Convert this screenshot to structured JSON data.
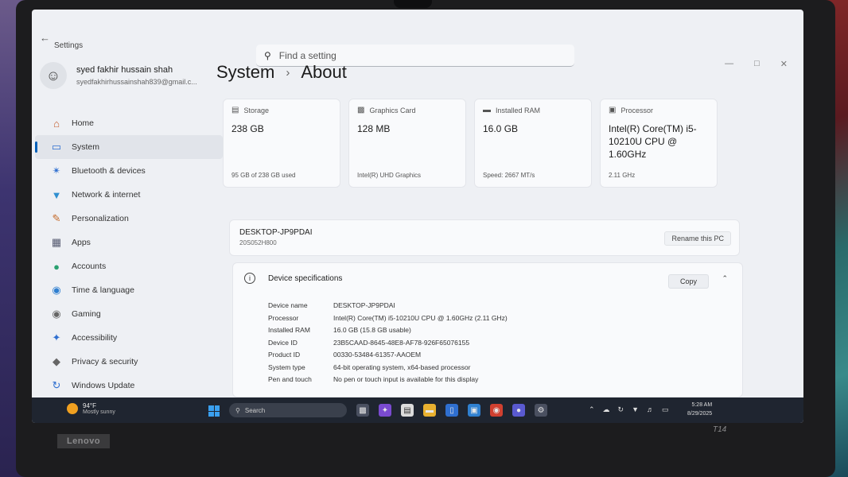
{
  "window": {
    "app_title": "Settings"
  },
  "search": {
    "placeholder": "Find a setting"
  },
  "user": {
    "name": "syed fakhir hussain shah",
    "email": "syedfakhirhussainshah839@gmail.c..."
  },
  "sidebar": {
    "items": [
      {
        "label": "Home",
        "icon": "home-icon"
      },
      {
        "label": "System",
        "icon": "system-icon",
        "active": true
      },
      {
        "label": "Bluetooth & devices",
        "icon": "bluetooth-icon"
      },
      {
        "label": "Network & internet",
        "icon": "network-icon"
      },
      {
        "label": "Personalization",
        "icon": "brush-icon"
      },
      {
        "label": "Apps",
        "icon": "apps-icon"
      },
      {
        "label": "Accounts",
        "icon": "accounts-icon"
      },
      {
        "label": "Time & language",
        "icon": "globe-icon"
      },
      {
        "label": "Gaming",
        "icon": "gamepad-icon"
      },
      {
        "label": "Accessibility",
        "icon": "accessibility-icon"
      },
      {
        "label": "Privacy & security",
        "icon": "shield-icon"
      },
      {
        "label": "Windows Update",
        "icon": "update-icon"
      }
    ]
  },
  "breadcrumb": {
    "parent": "System",
    "current": "About"
  },
  "cards": [
    {
      "label": "Storage",
      "value": "238 GB",
      "foot": "95 GB of 238 GB used",
      "icon": "storage-icon"
    },
    {
      "label": "Graphics Card",
      "value": "128 MB",
      "foot": "Intel(R) UHD Graphics",
      "icon": "graphics-icon"
    },
    {
      "label": "Installed RAM",
      "value": "16.0 GB",
      "foot": "Speed: 2667 MT/s",
      "icon": "ram-icon"
    },
    {
      "label": "Processor",
      "value": "Intel(R) Core(TM) i5-10210U CPU @ 1.60GHz",
      "foot": "2.11 GHz",
      "icon": "processor-icon"
    }
  ],
  "pc": {
    "name": "DESKTOP-JP9PDAI",
    "model": "20S052H800",
    "rename_label": "Rename this PC"
  },
  "specs": {
    "title": "Device specifications",
    "copy_label": "Copy",
    "rows": [
      {
        "key": "Device name",
        "value": "DESKTOP-JP9PDAI"
      },
      {
        "key": "Processor",
        "value": "Intel(R) Core(TM) i5-10210U CPU @ 1.60GHz (2.11 GHz)"
      },
      {
        "key": "Installed RAM",
        "value": "16.0 GB (15.8 GB usable)"
      },
      {
        "key": "Device ID",
        "value": "23B5CAAD-8645-48E8-AF78-926F65076155"
      },
      {
        "key": "Product ID",
        "value": "00330-53484-61357-AAOEM"
      },
      {
        "key": "System type",
        "value": "64-bit operating system, x64-based processor"
      },
      {
        "key": "Pen and touch",
        "value": "No pen or touch input is available for this display"
      }
    ]
  },
  "taskbar": {
    "temp": "94°F",
    "condition": "Mostly sunny",
    "search_label": "Search",
    "time": "5:28 AM",
    "date": "8/29/2025"
  },
  "hardware": {
    "brand": "Lenovo",
    "model": "T14"
  }
}
